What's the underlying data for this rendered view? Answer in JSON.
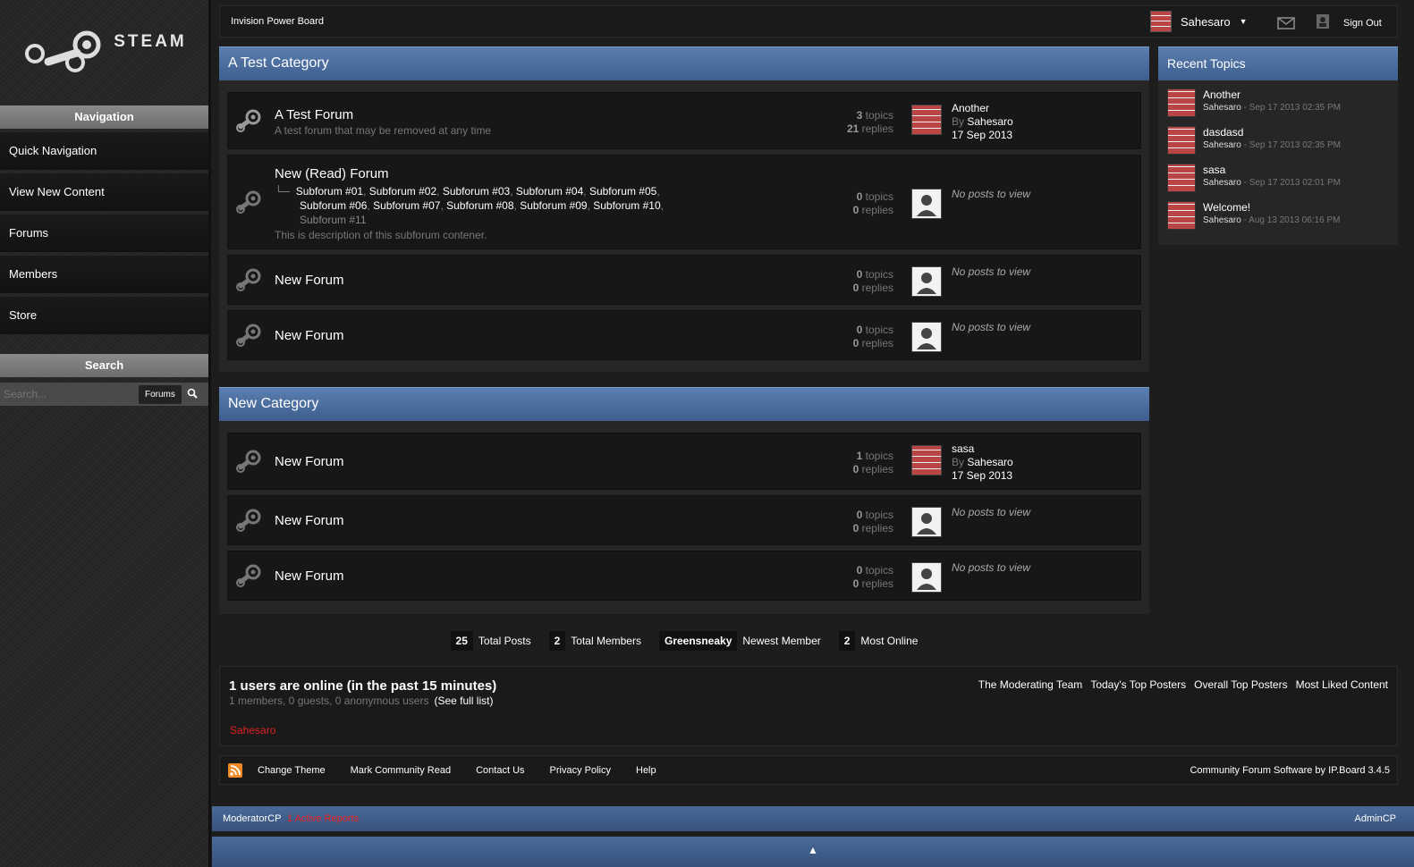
{
  "brand": {
    "logo_text": "STEAM"
  },
  "sidebar": {
    "nav_heading": "Navigation",
    "nav_items": [
      {
        "label": "Quick Navigation"
      },
      {
        "label": "View New Content"
      },
      {
        "label": "Forums"
      },
      {
        "label": "Members"
      },
      {
        "label": "Store"
      }
    ],
    "search_heading": "Search",
    "search_placeholder": "Search...",
    "search_scope": "Forums"
  },
  "topbar": {
    "board_title": "Invision Power Board",
    "username": "Sahesaro",
    "sign_out": "Sign Out"
  },
  "categories": [
    {
      "title": "A Test Category",
      "forums": [
        {
          "name": "A Test Forum",
          "description": "A test forum that may be removed at any time",
          "topics": "3",
          "replies": "21",
          "last_title": "Another",
          "last_by_prefix": "By",
          "last_by": "Sahesaro",
          "last_date": "17 Sep 2013"
        },
        {
          "name": "New (Read) Forum",
          "subforums": [
            "Subforum #01",
            "Subforum #02",
            "Subforum #03",
            "Subforum #04",
            "Subforum #05",
            "Subforum #06",
            "Subforum #07",
            "Subforum #08",
            "Subforum #09",
            "Subforum #10",
            "Subforum #11"
          ],
          "description": "This is description of this subforum contener.",
          "topics": "0",
          "replies": "0",
          "no_posts": "No posts to view"
        },
        {
          "name": "New Forum",
          "topics": "0",
          "replies": "0",
          "no_posts": "No posts to view"
        },
        {
          "name": "New Forum",
          "topics": "0",
          "replies": "0",
          "no_posts": "No posts to view"
        }
      ]
    },
    {
      "title": "New Category",
      "forums": [
        {
          "name": "New Forum",
          "topics": "1",
          "replies": "0",
          "last_title": "sasa",
          "last_by_prefix": "By",
          "last_by": "Sahesaro",
          "last_date": "17 Sep 2013"
        },
        {
          "name": "New Forum",
          "topics": "0",
          "replies": "0",
          "no_posts": "No posts to view"
        },
        {
          "name": "New Forum",
          "topics": "0",
          "replies": "0",
          "no_posts": "No posts to view"
        }
      ]
    }
  ],
  "stat_labels": {
    "topics": "topics",
    "replies": "replies"
  },
  "recent_topics": {
    "title": "Recent Topics",
    "items": [
      {
        "title": "Another",
        "author": "Sahesaro",
        "date": "- Sep 17 2013 02:35 PM"
      },
      {
        "title": "dasdasd",
        "author": "Sahesaro",
        "date": "- Sep 17 2013 02:35 PM"
      },
      {
        "title": "sasa",
        "author": "Sahesaro",
        "date": "- Sep 17 2013 02:01 PM"
      },
      {
        "title": "Welcome!",
        "author": "Sahesaro",
        "date": "- Aug 13 2013 06:16 PM"
      }
    ]
  },
  "board_stats": [
    {
      "value": "25",
      "label": "Total Posts"
    },
    {
      "value": "2",
      "label": "Total Members"
    },
    {
      "value": "Greensneaky",
      "label": "Newest Member"
    },
    {
      "value": "2",
      "label": "Most Online"
    }
  ],
  "online": {
    "title": "1 users are online (in the past 15 minutes)",
    "subtitle": "1 members, 0 guests, 0 anonymous users",
    "full_list": "(See full list)",
    "user": "Sahesaro",
    "links": [
      "The Moderating Team",
      "Today's Top Posters",
      "Overall Top Posters",
      "Most Liked Content"
    ]
  },
  "footer": {
    "links": [
      "Change Theme",
      "Mark Community Read",
      "Contact Us",
      "Privacy Policy",
      "Help"
    ],
    "powered": "Community Forum Software by IP.Board 3.4.5"
  },
  "modbar": {
    "moderator_cp": "ModeratorCP",
    "reports": "1 Active Reports",
    "admin_cp": "AdminCP"
  },
  "bottombar": {
    "arrow": "▲"
  },
  "colors": {
    "accent": "#4a6fa5",
    "online_user": "#dd2222",
    "reports": "#ee2222"
  }
}
